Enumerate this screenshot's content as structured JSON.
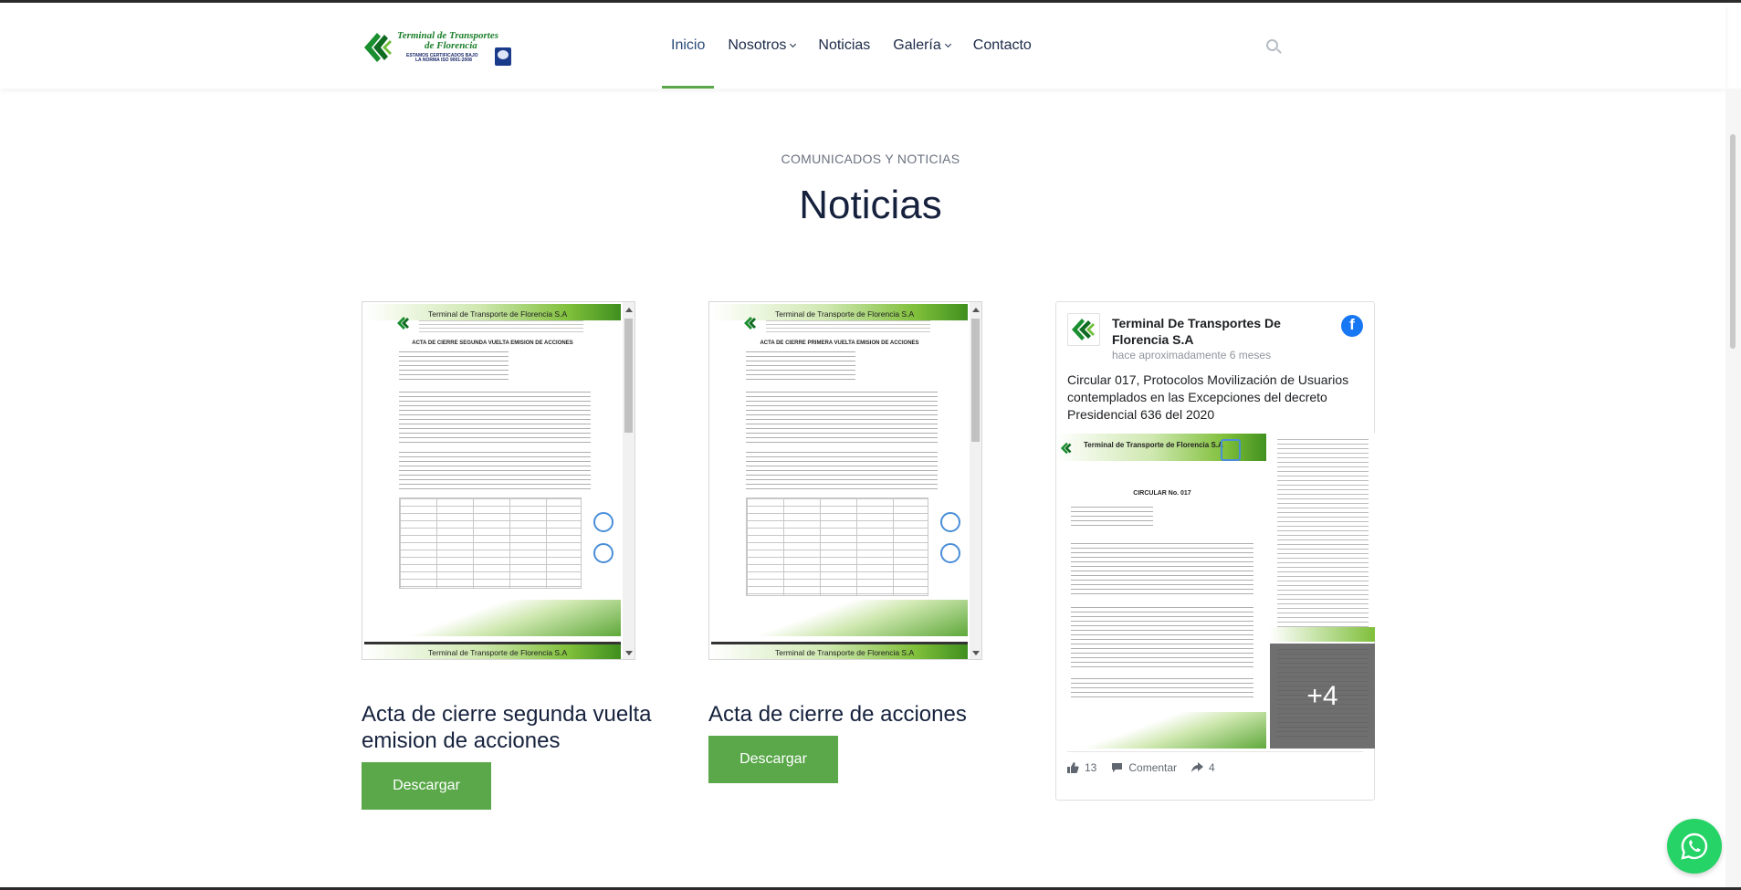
{
  "header": {
    "logo": {
      "line1": "Terminal de Transportes",
      "line2": "de Florencia",
      "line3": "ESTAMOS CERTIFICADOS BAJO",
      "line4": "LA NORMA ISO 9001:2008"
    },
    "nav": [
      {
        "label": "Inicio",
        "active": true
      },
      {
        "label": "Nosotros",
        "dropdown": true
      },
      {
        "label": "Noticias"
      },
      {
        "label": "Galería",
        "dropdown": true
      },
      {
        "label": "Contacto"
      }
    ],
    "search_icon": "search-icon"
  },
  "section": {
    "eyebrow": "COMUNICADOS Y NOTICIAS",
    "title": "Noticias"
  },
  "documents": [
    {
      "doc_header": "Terminal de Transporte de Florencia S.A",
      "doc_title": "ACTA DE CIERRE SEGUNDA VUELTA EMISION DE ACCIONES",
      "title": "Acta de cierre segunda vuelta emision de acciones",
      "button": "Descargar"
    },
    {
      "doc_header": "Terminal de Transporte de Florencia S.A",
      "doc_title": "ACTA DE CIERRE PRIMERA VUELTA EMISION DE ACCIONES",
      "title": "Acta de cierre de acciones",
      "button": "Descargar"
    }
  ],
  "facebook_post": {
    "page_name": "Terminal De Transportes De Florencia S.A",
    "time": "hace aproximadamente 6 meses",
    "text": "Circular 017, Protocolos Movilización de Usuarios contemplados en las Excepciones del decreto Presidencial 636 del 2020",
    "image_header": "Terminal de Transporte de Florencia S.A",
    "image_title": "CIRCULAR No. 017",
    "more_images": "+4",
    "likes": "13",
    "comment_label": "Comentar",
    "shares": "4",
    "brand_color": "#1877f2"
  },
  "colors": {
    "accent_green": "#5aa84a",
    "heading_navy": "#16223d",
    "whatsapp_green": "#25d366"
  }
}
